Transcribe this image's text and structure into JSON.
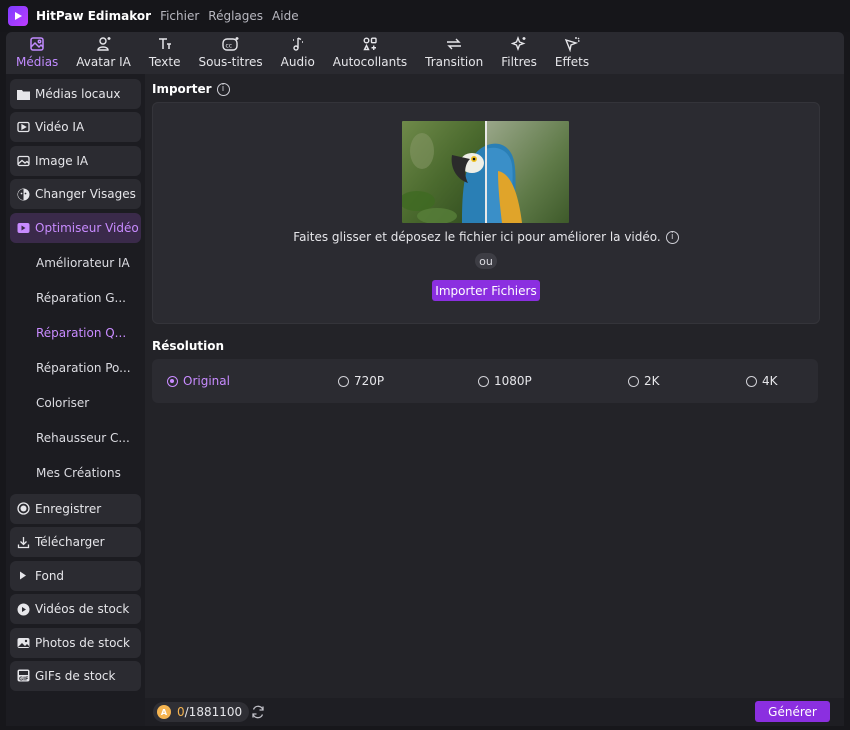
{
  "app": {
    "title": "HitPaw Edimakor",
    "menu": [
      "Fichier",
      "Réglages",
      "Aide"
    ]
  },
  "toolbar": [
    {
      "label": "Médias",
      "icon": "media-icon",
      "active": true
    },
    {
      "label": "Avatar IA",
      "icon": "avatar-icon"
    },
    {
      "label": "Texte",
      "icon": "text-icon"
    },
    {
      "label": "Sous-titres",
      "icon": "subtitles-icon"
    },
    {
      "label": "Audio",
      "icon": "audio-icon"
    },
    {
      "label": "Autocollants",
      "icon": "stickers-icon"
    },
    {
      "label": "Transition",
      "icon": "transition-icon"
    },
    {
      "label": "Filtres",
      "icon": "filters-icon"
    },
    {
      "label": "Effets",
      "icon": "effects-icon"
    }
  ],
  "sidebar": {
    "top_items": [
      {
        "label": "Médias locaux",
        "icon": "folder-icon"
      },
      {
        "label": "Vidéo IA",
        "icon": "ai-video-icon"
      },
      {
        "label": "Image IA",
        "icon": "ai-image-icon"
      },
      {
        "label": "Changer Visages",
        "icon": "face-swap-icon"
      },
      {
        "label": "Optimiseur Vidéo",
        "icon": "video-enhancer-icon",
        "active": true
      }
    ],
    "sub_items": [
      {
        "label": "Améliorateur IA"
      },
      {
        "label": "Réparation G..."
      },
      {
        "label": "Réparation Q...",
        "active": true
      },
      {
        "label": "Réparation Po..."
      },
      {
        "label": "Coloriser"
      },
      {
        "label": "Rehausseur C..."
      },
      {
        "label": "Mes Créations"
      }
    ],
    "bottom_items": [
      {
        "label": "Enregistrer",
        "icon": "record-icon"
      },
      {
        "label": "Télécharger",
        "icon": "download-icon"
      },
      {
        "label": "Fond",
        "icon": "play-triangle-icon"
      },
      {
        "label": "Vidéos de stock",
        "icon": "stock-video-icon"
      },
      {
        "label": "Photos de stock",
        "icon": "stock-photo-icon"
      },
      {
        "label": "GIFs de stock",
        "icon": "gif-icon"
      }
    ]
  },
  "import": {
    "title": "Importer",
    "drop_text": "Faites glisser et déposez le fichier ici pour améliorer la vidéo.",
    "or_text": "ou",
    "button_label": "Importer Fichiers"
  },
  "resolution": {
    "title": "Résolution",
    "options": [
      {
        "label": "Original",
        "selected": true
      },
      {
        "label": "720P"
      },
      {
        "label": "1080P"
      },
      {
        "label": "2K"
      },
      {
        "label": "4K"
      }
    ]
  },
  "footer": {
    "credits_used": "0",
    "credits_total": "/1881100",
    "generate_label": "Générer"
  },
  "colors": {
    "accent": "#8b2fe0",
    "accent_text": "#c88bff",
    "coin": "#f5b451"
  }
}
